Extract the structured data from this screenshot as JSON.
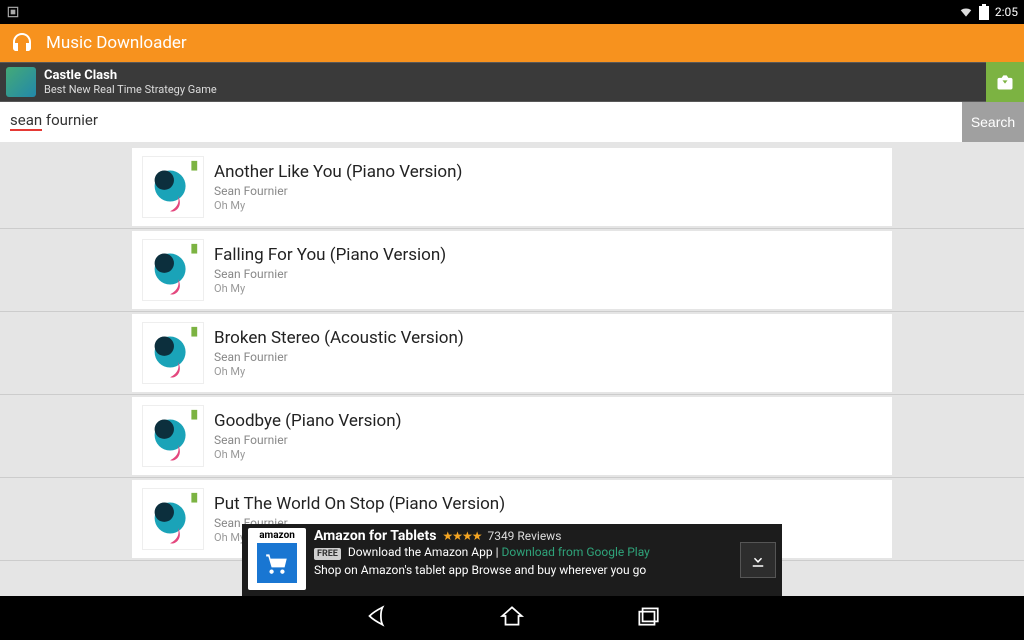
{
  "status": {
    "time": "2:05"
  },
  "appbar": {
    "title": "Music Downloader"
  },
  "promo": {
    "title": "Castle Clash",
    "subtitle": "Best New Real Time Strategy Game"
  },
  "search": {
    "value_underlined": "sean",
    "value_rest": " fournier",
    "button_label": "Search"
  },
  "results": [
    {
      "title": "Another Like You (Piano Version)",
      "artist": "Sean Fournier",
      "album": "Oh My"
    },
    {
      "title": "Falling For You (Piano Version)",
      "artist": "Sean Fournier",
      "album": "Oh My"
    },
    {
      "title": "Broken Stereo (Acoustic Version)",
      "artist": "Sean Fournier",
      "album": "Oh My"
    },
    {
      "title": "Goodbye (Piano Version)",
      "artist": "Sean Fournier",
      "album": "Oh My"
    },
    {
      "title": "Put The World On Stop (Piano Version)",
      "artist": "Sean Fournier",
      "album": "Oh My"
    }
  ],
  "ad": {
    "brand": "amazon",
    "title": "Amazon for Tablets",
    "stars_display": "★★★★",
    "reviews": "7349 Reviews",
    "free_label": "FREE",
    "line2a": "Download the Amazon App |",
    "line2_link": "Download from Google Play",
    "line3": "Shop on Amazon's tablet app Browse and buy wherever you go"
  }
}
